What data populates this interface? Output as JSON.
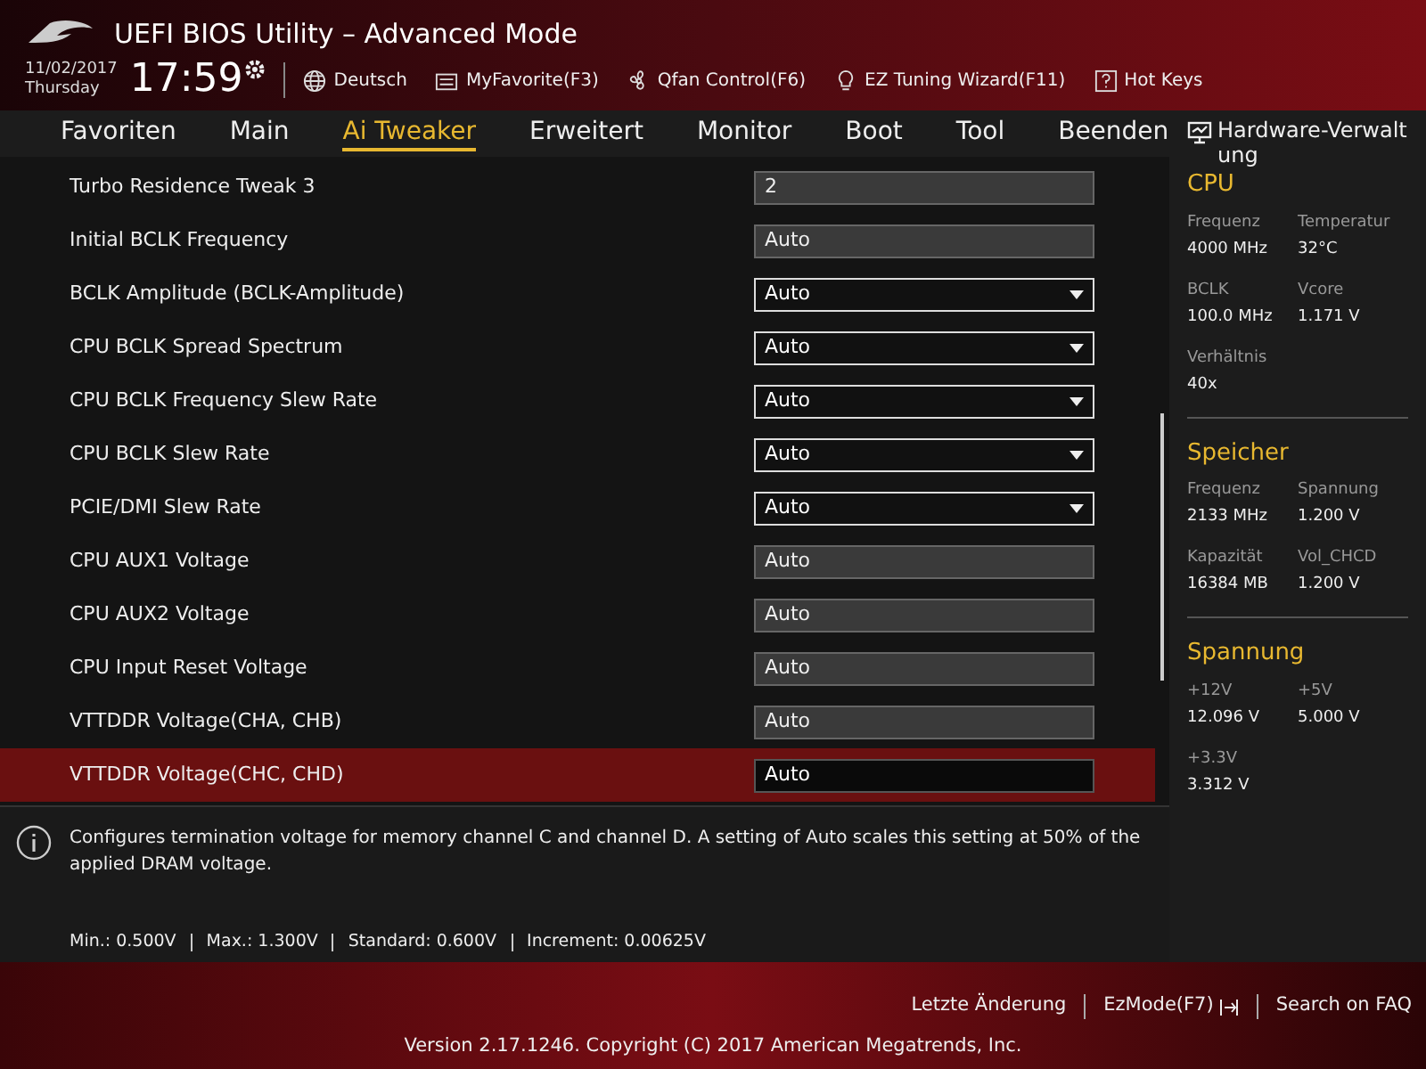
{
  "header": {
    "title": "UEFI BIOS Utility – Advanced Mode",
    "date": "11/02/2017",
    "weekday": "Thursday",
    "time": "17:59",
    "tools": [
      {
        "kind": "language",
        "label": "Deutsch"
      },
      {
        "kind": "favorite",
        "label": "MyFavorite(F3)"
      },
      {
        "kind": "fan",
        "label": "Qfan Control(F6)"
      },
      {
        "kind": "wizard",
        "label": "EZ Tuning Wizard(F11)"
      },
      {
        "kind": "help",
        "label": "Hot Keys"
      }
    ]
  },
  "tabs": [
    {
      "label": "Favoriten",
      "selected": false
    },
    {
      "label": "Main",
      "selected": false
    },
    {
      "label": "Ai Tweaker",
      "selected": true
    },
    {
      "label": "Erweitert",
      "selected": false
    },
    {
      "label": "Monitor",
      "selected": false
    },
    {
      "label": "Boot",
      "selected": false
    },
    {
      "label": "Tool",
      "selected": false
    },
    {
      "label": "Beenden",
      "selected": false
    }
  ],
  "settings": [
    {
      "label": "Turbo Residence Tweak 3",
      "value": "2",
      "kind": "text",
      "selected": false
    },
    {
      "label": "Initial BCLK Frequency",
      "value": "Auto",
      "kind": "text",
      "selected": false
    },
    {
      "label": "BCLK Amplitude (BCLK-Amplitude)",
      "value": "Auto",
      "kind": "dropdown",
      "selected": false
    },
    {
      "label": "CPU BCLK Spread Spectrum",
      "value": "Auto",
      "kind": "dropdown",
      "selected": false
    },
    {
      "label": "CPU BCLK Frequency Slew Rate",
      "value": "Auto",
      "kind": "dropdown",
      "selected": false
    },
    {
      "label": "CPU BCLK Slew Rate",
      "value": "Auto",
      "kind": "dropdown",
      "selected": false
    },
    {
      "label": "PCIE/DMI Slew Rate",
      "value": "Auto",
      "kind": "dropdown",
      "selected": false
    },
    {
      "label": "CPU AUX1 Voltage",
      "value": "Auto",
      "kind": "text",
      "selected": false
    },
    {
      "label": "CPU AUX2 Voltage",
      "value": "Auto",
      "kind": "text",
      "selected": false
    },
    {
      "label": "CPU Input Reset Voltage",
      "value": "Auto",
      "kind": "text",
      "selected": false
    },
    {
      "label": "VTTDDR Voltage(CHA, CHB)",
      "value": "Auto",
      "kind": "text",
      "selected": false
    },
    {
      "label": "VTTDDR Voltage(CHC, CHD)",
      "value": "Auto",
      "kind": "text",
      "selected": true
    }
  ],
  "help": {
    "text": "Configures termination voltage for memory channel C and channel D. A setting of Auto scales this setting at 50% of the applied DRAM voltage.",
    "limits": [
      "Min.: 0.500V",
      "Max.: 1.300V",
      "Standard: 0.600V",
      "Increment: 0.00625V"
    ]
  },
  "hardware": {
    "title": "Hardware-Verwaltung",
    "sections": [
      {
        "title": "CPU",
        "items": [
          {
            "label": "Frequenz",
            "value": "4000 MHz"
          },
          {
            "label": "Temperatur",
            "value": "32°C"
          },
          {
            "label": "BCLK",
            "value": "100.0 MHz"
          },
          {
            "label": "Vcore",
            "value": "1.171 V"
          },
          {
            "label": "Verhältnis",
            "value": "40x"
          }
        ]
      },
      {
        "title": "Speicher",
        "items": [
          {
            "label": "Frequenz",
            "value": "2133 MHz"
          },
          {
            "label": "Spannung",
            "value": "1.200 V"
          },
          {
            "label": "Kapazität",
            "value": "16384 MB"
          },
          {
            "label": "Vol_CHCD",
            "value": "1.200 V"
          }
        ]
      },
      {
        "title": "Spannung",
        "items": [
          {
            "label": "+12V",
            "value": "12.096 V"
          },
          {
            "label": "+5V",
            "value": "5.000 V"
          },
          {
            "label": "+3.3V",
            "value": "3.312 V"
          }
        ]
      }
    ]
  },
  "footer": {
    "actions": [
      {
        "kind": "history",
        "label": "Letzte Änderung"
      },
      {
        "kind": "ezmode",
        "label": "EzMode(F7)"
      },
      {
        "kind": "faq",
        "label": "Search on FAQ"
      }
    ],
    "version": "Version 2.17.1246. Copyright (C) 2017 American Megatrends, Inc."
  }
}
